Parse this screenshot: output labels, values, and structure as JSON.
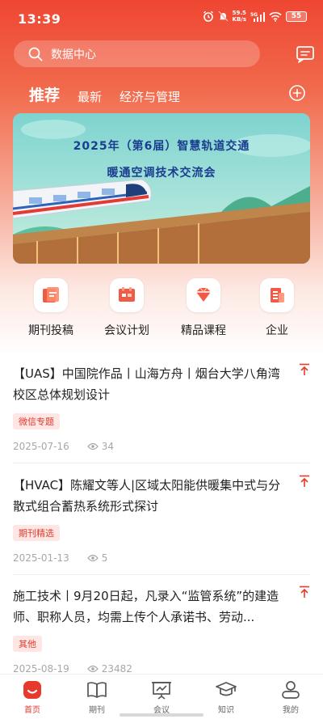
{
  "status": {
    "time": "13:39",
    "net_speed_top": "59.5",
    "net_speed_bottom": "KB/s",
    "signal": "5G",
    "battery": "55"
  },
  "search": {
    "placeholder": "数据中心"
  },
  "tabs": [
    {
      "label": "推荐",
      "active": true
    },
    {
      "label": "最新",
      "active": false
    },
    {
      "label": "经济与管理",
      "active": false
    }
  ],
  "banner": {
    "line1": "2025年（第6届）智慧轨道交通",
    "line2": "暖通空调技术交流会"
  },
  "quick_entries": [
    {
      "label": "期刊投稿",
      "icon": "journal-icon"
    },
    {
      "label": "会议计划",
      "icon": "meeting-icon"
    },
    {
      "label": "精品课程",
      "icon": "course-icon"
    },
    {
      "label": "企业",
      "icon": "enterprise-icon"
    }
  ],
  "articles": [
    {
      "title": "【UAS】中国院作品丨山海方舟丨烟台大学八角湾校区总体规划设计",
      "tag": "微信专题",
      "date": "2025-07-16",
      "views": "34"
    },
    {
      "title": "【HVAC】陈耀文等人|区域太阳能供暖集中式与分散式组合蓄热系统形式探讨",
      "tag": "期刊精选",
      "date": "2025-01-13",
      "views": "5"
    },
    {
      "title": "施工技术丨9月20日起，凡录入“监管系统”的建造师、职称人员，均需上传个人承诺书、劳动...",
      "tag": "其他",
      "date": "2025-08-19",
      "views": "23482"
    }
  ],
  "bottom_nav": [
    {
      "label": "首页",
      "active": true
    },
    {
      "label": "期刊",
      "active": false
    },
    {
      "label": "会议",
      "active": false
    },
    {
      "label": "知识",
      "active": false
    },
    {
      "label": "我的",
      "active": false
    }
  ],
  "colors": {
    "accent": "#e53a2c",
    "header_top": "#ef4632",
    "tag_bg": "#fde6e3"
  }
}
